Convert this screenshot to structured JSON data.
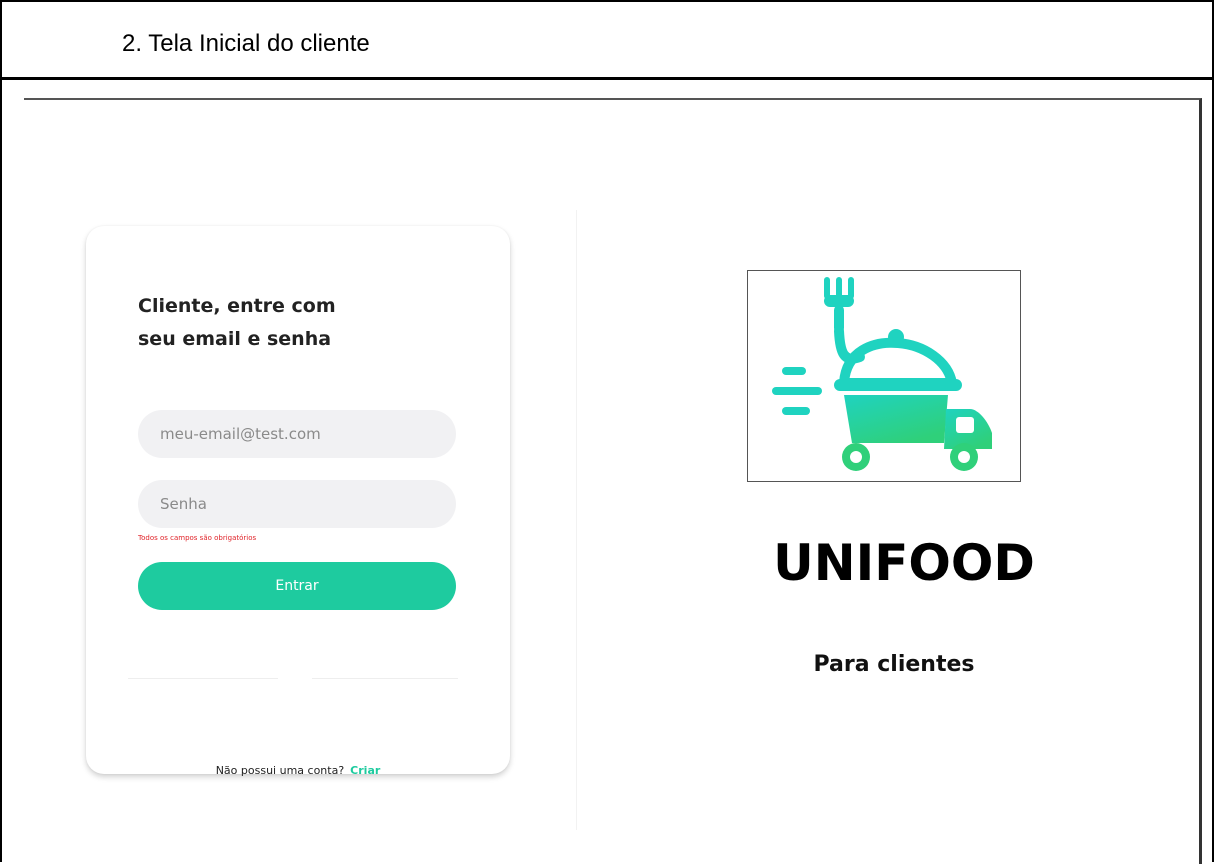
{
  "document": {
    "heading": "2. Tela Inicial do cliente"
  },
  "login": {
    "title_line1": "Cliente, entre com",
    "title_line2": "seu email e senha",
    "email_placeholder": "meu-email@test.com",
    "password_placeholder": "Senha",
    "validation_message": "Todos os campos são obrigatórios",
    "submit_label": "Entrar",
    "signup_prompt": "Não possui uma conta?",
    "signup_link": "Criar"
  },
  "brand": {
    "logo_icon": "food-delivery-truck-icon",
    "name": "UNIFOOD",
    "subtitle": "Para clientes"
  },
  "colors": {
    "accent": "#1ecb9f",
    "error": "#e0242a",
    "input_background": "#f1f1f3"
  }
}
